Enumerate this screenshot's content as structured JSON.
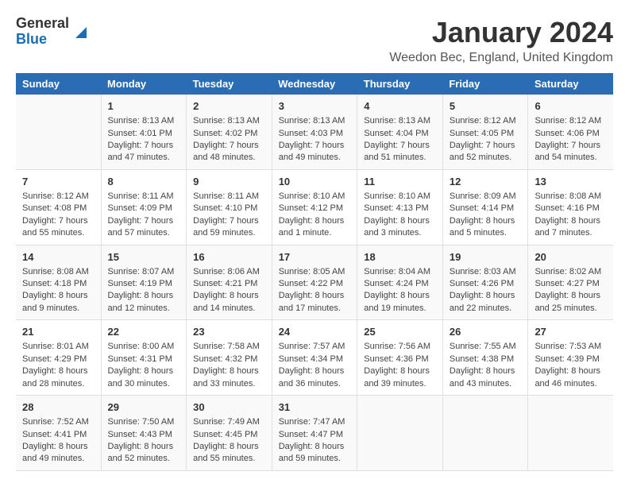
{
  "logo": {
    "general": "General",
    "blue": "Blue"
  },
  "title": {
    "month": "January 2024",
    "location": "Weedon Bec, England, United Kingdom"
  },
  "days": [
    "Sunday",
    "Monday",
    "Tuesday",
    "Wednesday",
    "Thursday",
    "Friday",
    "Saturday"
  ],
  "weeks": [
    [
      {
        "num": "",
        "lines": []
      },
      {
        "num": "1",
        "lines": [
          "Sunrise: 8:13 AM",
          "Sunset: 4:01 PM",
          "Daylight: 7 hours",
          "and 47 minutes."
        ]
      },
      {
        "num": "2",
        "lines": [
          "Sunrise: 8:13 AM",
          "Sunset: 4:02 PM",
          "Daylight: 7 hours",
          "and 48 minutes."
        ]
      },
      {
        "num": "3",
        "lines": [
          "Sunrise: 8:13 AM",
          "Sunset: 4:03 PM",
          "Daylight: 7 hours",
          "and 49 minutes."
        ]
      },
      {
        "num": "4",
        "lines": [
          "Sunrise: 8:13 AM",
          "Sunset: 4:04 PM",
          "Daylight: 7 hours",
          "and 51 minutes."
        ]
      },
      {
        "num": "5",
        "lines": [
          "Sunrise: 8:12 AM",
          "Sunset: 4:05 PM",
          "Daylight: 7 hours",
          "and 52 minutes."
        ]
      },
      {
        "num": "6",
        "lines": [
          "Sunrise: 8:12 AM",
          "Sunset: 4:06 PM",
          "Daylight: 7 hours",
          "and 54 minutes."
        ]
      }
    ],
    [
      {
        "num": "7",
        "lines": [
          "Sunrise: 8:12 AM",
          "Sunset: 4:08 PM",
          "Daylight: 7 hours",
          "and 55 minutes."
        ]
      },
      {
        "num": "8",
        "lines": [
          "Sunrise: 8:11 AM",
          "Sunset: 4:09 PM",
          "Daylight: 7 hours",
          "and 57 minutes."
        ]
      },
      {
        "num": "9",
        "lines": [
          "Sunrise: 8:11 AM",
          "Sunset: 4:10 PM",
          "Daylight: 7 hours",
          "and 59 minutes."
        ]
      },
      {
        "num": "10",
        "lines": [
          "Sunrise: 8:10 AM",
          "Sunset: 4:12 PM",
          "Daylight: 8 hours",
          "and 1 minute."
        ]
      },
      {
        "num": "11",
        "lines": [
          "Sunrise: 8:10 AM",
          "Sunset: 4:13 PM",
          "Daylight: 8 hours",
          "and 3 minutes."
        ]
      },
      {
        "num": "12",
        "lines": [
          "Sunrise: 8:09 AM",
          "Sunset: 4:14 PM",
          "Daylight: 8 hours",
          "and 5 minutes."
        ]
      },
      {
        "num": "13",
        "lines": [
          "Sunrise: 8:08 AM",
          "Sunset: 4:16 PM",
          "Daylight: 8 hours",
          "and 7 minutes."
        ]
      }
    ],
    [
      {
        "num": "14",
        "lines": [
          "Sunrise: 8:08 AM",
          "Sunset: 4:18 PM",
          "Daylight: 8 hours",
          "and 9 minutes."
        ]
      },
      {
        "num": "15",
        "lines": [
          "Sunrise: 8:07 AM",
          "Sunset: 4:19 PM",
          "Daylight: 8 hours",
          "and 12 minutes."
        ]
      },
      {
        "num": "16",
        "lines": [
          "Sunrise: 8:06 AM",
          "Sunset: 4:21 PM",
          "Daylight: 8 hours",
          "and 14 minutes."
        ]
      },
      {
        "num": "17",
        "lines": [
          "Sunrise: 8:05 AM",
          "Sunset: 4:22 PM",
          "Daylight: 8 hours",
          "and 17 minutes."
        ]
      },
      {
        "num": "18",
        "lines": [
          "Sunrise: 8:04 AM",
          "Sunset: 4:24 PM",
          "Daylight: 8 hours",
          "and 19 minutes."
        ]
      },
      {
        "num": "19",
        "lines": [
          "Sunrise: 8:03 AM",
          "Sunset: 4:26 PM",
          "Daylight: 8 hours",
          "and 22 minutes."
        ]
      },
      {
        "num": "20",
        "lines": [
          "Sunrise: 8:02 AM",
          "Sunset: 4:27 PM",
          "Daylight: 8 hours",
          "and 25 minutes."
        ]
      }
    ],
    [
      {
        "num": "21",
        "lines": [
          "Sunrise: 8:01 AM",
          "Sunset: 4:29 PM",
          "Daylight: 8 hours",
          "and 28 minutes."
        ]
      },
      {
        "num": "22",
        "lines": [
          "Sunrise: 8:00 AM",
          "Sunset: 4:31 PM",
          "Daylight: 8 hours",
          "and 30 minutes."
        ]
      },
      {
        "num": "23",
        "lines": [
          "Sunrise: 7:58 AM",
          "Sunset: 4:32 PM",
          "Daylight: 8 hours",
          "and 33 minutes."
        ]
      },
      {
        "num": "24",
        "lines": [
          "Sunrise: 7:57 AM",
          "Sunset: 4:34 PM",
          "Daylight: 8 hours",
          "and 36 minutes."
        ]
      },
      {
        "num": "25",
        "lines": [
          "Sunrise: 7:56 AM",
          "Sunset: 4:36 PM",
          "Daylight: 8 hours",
          "and 39 minutes."
        ]
      },
      {
        "num": "26",
        "lines": [
          "Sunrise: 7:55 AM",
          "Sunset: 4:38 PM",
          "Daylight: 8 hours",
          "and 43 minutes."
        ]
      },
      {
        "num": "27",
        "lines": [
          "Sunrise: 7:53 AM",
          "Sunset: 4:39 PM",
          "Daylight: 8 hours",
          "and 46 minutes."
        ]
      }
    ],
    [
      {
        "num": "28",
        "lines": [
          "Sunrise: 7:52 AM",
          "Sunset: 4:41 PM",
          "Daylight: 8 hours",
          "and 49 minutes."
        ]
      },
      {
        "num": "29",
        "lines": [
          "Sunrise: 7:50 AM",
          "Sunset: 4:43 PM",
          "Daylight: 8 hours",
          "and 52 minutes."
        ]
      },
      {
        "num": "30",
        "lines": [
          "Sunrise: 7:49 AM",
          "Sunset: 4:45 PM",
          "Daylight: 8 hours",
          "and 55 minutes."
        ]
      },
      {
        "num": "31",
        "lines": [
          "Sunrise: 7:47 AM",
          "Sunset: 4:47 PM",
          "Daylight: 8 hours",
          "and 59 minutes."
        ]
      },
      {
        "num": "",
        "lines": []
      },
      {
        "num": "",
        "lines": []
      },
      {
        "num": "",
        "lines": []
      }
    ]
  ]
}
